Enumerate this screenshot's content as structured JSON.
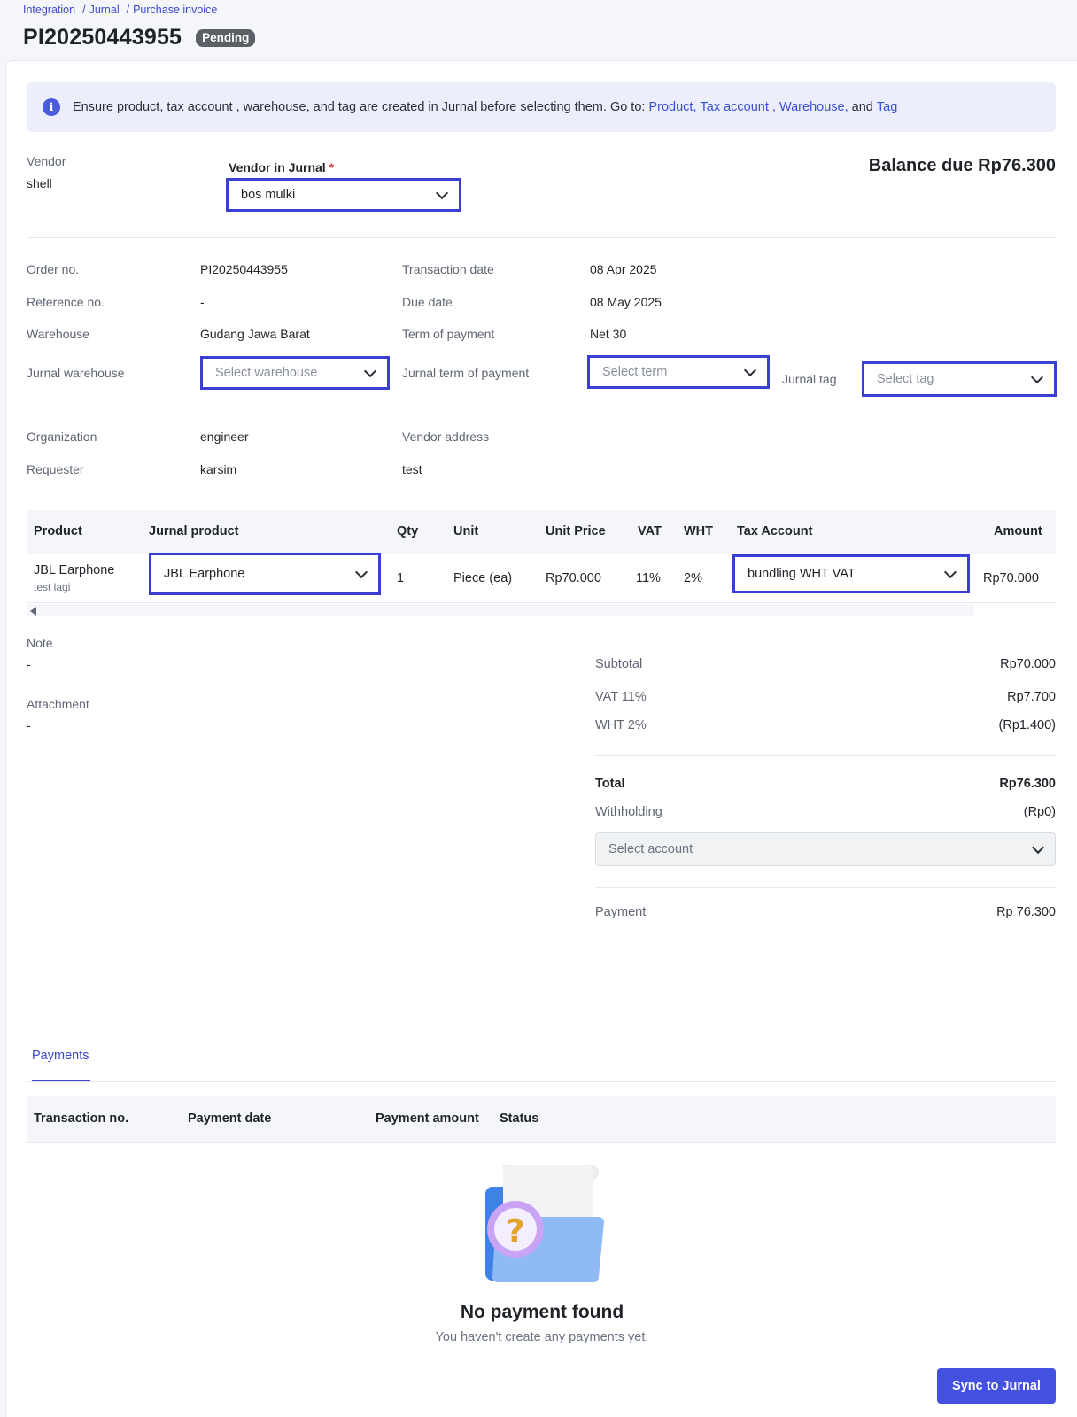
{
  "breadcrumb": [
    "Integration",
    "Jurnal",
    "Purchase invoice"
  ],
  "page": {
    "title": "PI20250443955",
    "status": "Pending"
  },
  "banner": {
    "text": "Ensure product, tax account , warehouse, and tag are created in Jurnal before selecting them. Go to:",
    "links": [
      "Product,",
      "Tax account ,",
      "Warehouse,",
      "Tag"
    ],
    "and": "and"
  },
  "vendor": {
    "label": "Vendor",
    "value": "shell",
    "jurnal_label": "Vendor in Jurnal",
    "required": "*",
    "jurnal_value": "bos mulki"
  },
  "balance": "Balance due Rp76.300",
  "details": {
    "order_label": "Order no.",
    "order_value": "PI20250443955",
    "reference_label": "Reference no.",
    "reference_value": "-",
    "warehouse_label": "Warehouse",
    "warehouse_value": "Gudang Jawa Barat",
    "jurnal_warehouse_label": "Jurnal warehouse",
    "jurnal_warehouse_placeholder": "Select warehouse",
    "transaction_label": "Transaction date",
    "transaction_value": "08 Apr 2025",
    "due_label": "Due date",
    "due_value": "08 May 2025",
    "term_label": "Term of payment",
    "term_value": "Net 30",
    "jurnal_term_label": "Jurnal term of payment",
    "jurnal_term_placeholder": "Select term",
    "tag_label": "Jurnal tag",
    "tag_placeholder": "Select tag",
    "organization_label": "Organization",
    "organization_value": "engineer",
    "requester_label": "Requester",
    "requester_value": "karsim",
    "vendor_address_label": "Vendor address",
    "vendor_address_value": "test"
  },
  "product_table": {
    "headers": [
      "Product",
      "Jurnal product",
      "Qty",
      "Unit",
      "Unit Price",
      "VAT",
      "WHT",
      "Tax Account",
      "Amount"
    ],
    "rows": [
      {
        "product": "JBL Earphone",
        "product_note": "test lagi",
        "jurnal_product": "JBL Earphone",
        "qty": "1",
        "unit": "Piece (ea)",
        "unit_price": "Rp70.000",
        "vat": "11%",
        "wht": "2%",
        "tax_account": "bundling WHT VAT",
        "amount": "Rp70.000"
      }
    ]
  },
  "notes": {
    "note_label": "Note",
    "note_value": "-",
    "attachment_label": "Attachment",
    "attachment_value": "-"
  },
  "summary": {
    "subtotal_label": "Subtotal",
    "subtotal_value": "Rp70.000",
    "vat_label": "VAT 11%",
    "vat_value": "Rp7.700",
    "wht_label": "WHT 2%",
    "wht_value": "(Rp1.400)",
    "total_label": "Total",
    "total_value": "Rp76.300",
    "withholding_label": "Withholding",
    "withholding_value": "(Rp0)",
    "account_placeholder": "Select account",
    "payment_label": "Payment",
    "payment_value": "Rp 76.300"
  },
  "payments": {
    "tab": "Payments",
    "headers": [
      "Transaction no.",
      "Payment date",
      "Payment amount",
      "Status"
    ],
    "empty_title": "No payment found",
    "empty_sub": "You haven't create any payments yet."
  },
  "actions": {
    "sync_label": "Sync to Jurnal"
  },
  "colors": {
    "accent": "#4350e0",
    "highlight_border": "#3a3fd1",
    "badge": "#5b5f66"
  },
  "icons": {
    "info": "info-icon",
    "chevron": "chevron-down-icon",
    "empty": "folder-question-icon"
  }
}
